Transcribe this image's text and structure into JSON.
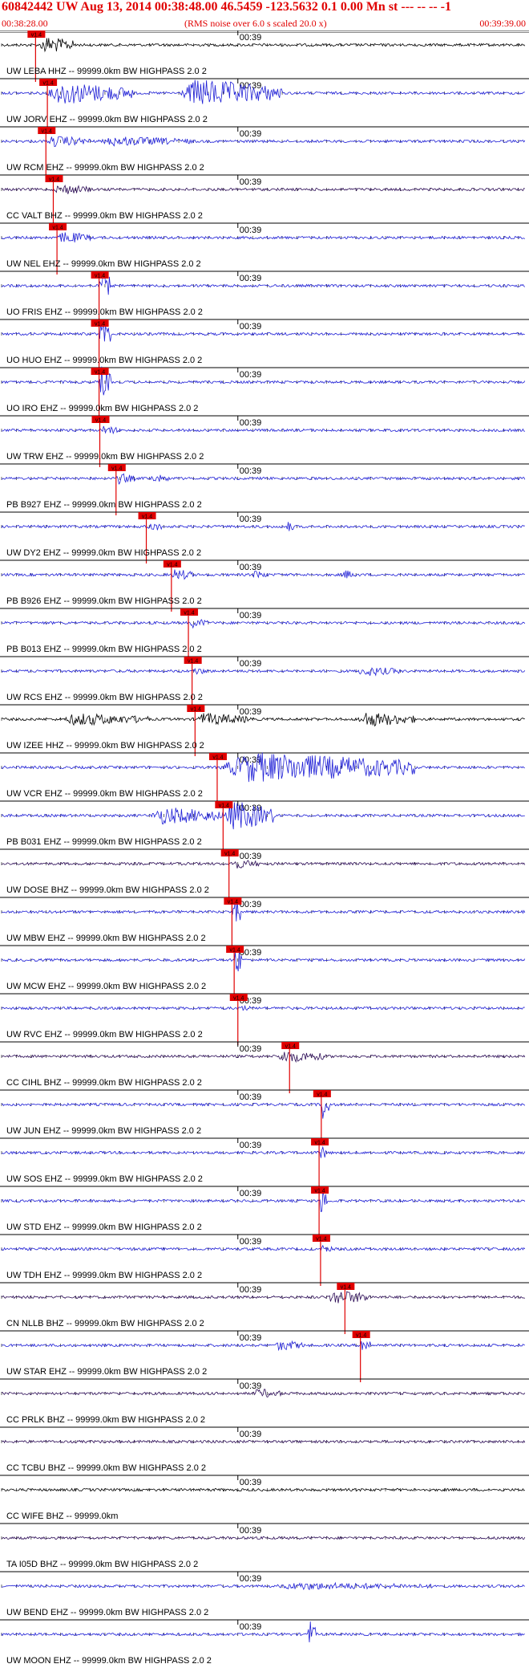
{
  "header": {
    "title": "60842442 UW Aug 13, 2014 00:38:48.00   46.5459 -123.5632  0.1 0.00 Mn st --- -- --  -1",
    "subtitle": "(RMS noise over 6.0 s scaled 20.0 x)",
    "time_start": "00:38:28.00",
    "time_end": "00:39:39.00"
  },
  "chart_data": {
    "type": "line",
    "title": "60842442 UW Aug 13, 2014 00:38:48.00   46.5459 -123.5632  0.1 0.00 Mn st --- -- --  -1",
    "time_range_seconds": [
      0,
      71
    ],
    "minute_mark_label": "00:39",
    "minute_mark_second": 32,
    "pick_label": "v1.4",
    "colors": {
      "blue": "#1f1fd6",
      "black": "#000000",
      "purple": "#2a0a55",
      "pick": "#e00000"
    },
    "traces": [
      {
        "label": "UW LEBA HHZ -- 99999.0km BW  HIGHPASS  2.0  2",
        "color": "black",
        "pick_s": 4.6,
        "bursts": [
          {
            "t": [
              5,
              10
            ],
            "amp": 1.4
          }
        ]
      },
      {
        "label": "UW JORV EHZ -- 99999.0km BW  HIGHPASS  2.0  2",
        "color": "blue",
        "pick_s": 6.2,
        "bursts": [
          {
            "t": [
              6,
              18
            ],
            "amp": 1.8
          },
          {
            "t": [
              24,
              38
            ],
            "amp": 2.2
          }
        ]
      },
      {
        "label": "UW RCM EHZ -- 99999.0km BW  HIGHPASS  2.0  2",
        "color": "blue",
        "pick_s": 6.0,
        "bursts": [
          {
            "t": [
              6,
              12
            ],
            "amp": 0.9
          },
          {
            "t": [
              13,
              26
            ],
            "amp": 0.8
          }
        ]
      },
      {
        "label": "CC VALT BHZ -- 99999.0km BW  HIGHPASS  2.0  2",
        "color": "purple",
        "pick_s": 7.0,
        "bursts": [
          {
            "t": [
              7,
              12
            ],
            "amp": 0.9
          }
        ]
      },
      {
        "label": "UW NEL EHZ -- 99999.0km BW  HIGHPASS  2.0  2",
        "color": "blue",
        "pick_s": 7.5,
        "bursts": [
          {
            "t": [
              7.5,
              12
            ],
            "amp": 1.0
          }
        ]
      },
      {
        "label": "UO FRIS EHZ -- 99999.0km BW  HIGHPASS  2.0  2",
        "color": "blue",
        "pick_s": 13.2,
        "bursts": [
          {
            "t": [
              13.2,
              14.8
            ],
            "amp": 2.6
          }
        ]
      },
      {
        "label": "UO HUO EHZ -- 99999.0km BW  HIGHPASS  2.0  2",
        "color": "blue",
        "pick_s": 13.2,
        "bursts": [
          {
            "t": [
              13.2,
              14.8
            ],
            "amp": 2.6
          }
        ]
      },
      {
        "label": "UO IRO EHZ -- 99999.0km BW  HIGHPASS  2.0  2",
        "color": "blue",
        "pick_s": 13.2,
        "bursts": [
          {
            "t": [
              13.2,
              14.8
            ],
            "amp": 2.6
          }
        ]
      },
      {
        "label": "UW TRW EHZ -- 99999.0km BW  HIGHPASS  2.0  2",
        "color": "blue",
        "pick_s": 13.3,
        "bursts": [
          {
            "t": [
              13.3,
              16
            ],
            "amp": 0.8
          }
        ]
      },
      {
        "label": "PB B927 EHZ -- 99999.0km BW  HIGHPASS  2.0  2",
        "color": "blue",
        "pick_s": 15.5,
        "bursts": [
          {
            "t": [
              15.5,
              18
            ],
            "amp": 0.9
          },
          {
            "t": [
              20,
              23
            ],
            "amp": 0.7
          }
        ]
      },
      {
        "label": "UW DY2 EHZ -- 99999.0km BW  HIGHPASS  2.0  2",
        "color": "blue",
        "pick_s": 19.6,
        "bursts": [
          {
            "t": [
              19.6,
              22
            ],
            "amp": 0.8
          },
          {
            "t": [
              38.5,
              39.5
            ],
            "amp": 1.0
          }
        ]
      },
      {
        "label": "PB B926 EHZ -- 99999.0km BW  HIGHPASS  2.0  2",
        "color": "blue",
        "pick_s": 23.0,
        "bursts": [
          {
            "t": [
              23,
              26
            ],
            "amp": 1.0
          },
          {
            "t": [
              34,
              36
            ],
            "amp": 0.8
          },
          {
            "t": [
              46,
              48
            ],
            "amp": 0.8
          }
        ]
      },
      {
        "label": "PB B013 EHZ -- 99999.0km BW  HIGHPASS  2.0  2",
        "color": "blue",
        "pick_s": 25.3,
        "bursts": [
          {
            "t": [
              25.3,
              28
            ],
            "amp": 0.8
          }
        ]
      },
      {
        "label": "UW RCS EHZ -- 99999.0km BW  HIGHPASS  2.0  2",
        "color": "blue",
        "pick_s": 25.8,
        "bursts": [
          {
            "t": [
              25.8,
              28
            ],
            "amp": 0.6
          },
          {
            "t": [
              48,
              54
            ],
            "amp": 0.8
          }
        ]
      },
      {
        "label": "UW IZEE HHZ -- 99999.0km BW  HIGHPASS  2.0  2",
        "color": "black",
        "pick_s": 26.2,
        "bursts": [
          {
            "t": [
              8,
              20
            ],
            "amp": 1.0
          },
          {
            "t": [
              26,
              34
            ],
            "amp": 1.0
          },
          {
            "t": [
              48,
              56
            ],
            "amp": 1.2
          }
        ]
      },
      {
        "label": "UW VCR EHZ -- 99999.0km BW  HIGHPASS  2.0  2",
        "color": "blue",
        "pick_s": 29.2,
        "bursts": [
          {
            "t": [
              29.2,
              56
            ],
            "amp": 2.4
          }
        ]
      },
      {
        "label": "PB B031 EHZ -- 99999.0km BW  HIGHPASS  2.0  2",
        "color": "blue",
        "pick_s": 30.0,
        "bursts": [
          {
            "t": [
              20,
              30
            ],
            "amp": 1.4
          },
          {
            "t": [
              30,
              37
            ],
            "amp": 2.4
          }
        ]
      },
      {
        "label": "UW DOSE BHZ -- 99999.0km BW  HIGHPASS  2.0  2",
        "color": "purple",
        "pick_s": 30.8,
        "bursts": [
          {
            "t": [
              30.8,
              35
            ],
            "amp": 0.8
          }
        ]
      },
      {
        "label": "UW MBW EHZ -- 99999.0km BW  HIGHPASS  2.0  2",
        "color": "blue",
        "pick_s": 31.2,
        "bursts": [
          {
            "t": [
              31.2,
              32.4
            ],
            "amp": 2.6
          }
        ]
      },
      {
        "label": "UW MCW EHZ -- 99999.0km BW  HIGHPASS  2.0  2",
        "color": "blue",
        "pick_s": 31.5,
        "bursts": [
          {
            "t": [
              31.5,
              32.6
            ],
            "amp": 2.6
          }
        ]
      },
      {
        "label": "UW RVC EHZ -- 99999.0km BW  HIGHPASS  2.0  2",
        "color": "blue",
        "pick_s": 32.0,
        "bursts": [
          {
            "t": [
              32,
              34
            ],
            "amp": 0.5
          }
        ]
      },
      {
        "label": "CC CIHL BHZ -- 99999.0km BW  HIGHPASS  2.0  2",
        "color": "purple",
        "pick_s": 39.0,
        "bursts": [
          {
            "t": [
              37,
              44
            ],
            "amp": 1.0
          }
        ]
      },
      {
        "label": "UW JUN EHZ -- 99999.0km BW  HIGHPASS  2.0  2",
        "color": "blue",
        "pick_s": 43.3,
        "bursts": [
          {
            "t": [
              43.3,
              44.5
            ],
            "amp": 2.6
          }
        ]
      },
      {
        "label": "UW SOS EHZ -- 99999.0km BW  HIGHPASS  2.0  2",
        "color": "blue",
        "pick_s": 43.0,
        "bursts": [
          {
            "t": [
              43,
              44
            ],
            "amp": 1.4
          }
        ]
      },
      {
        "label": "UW STD EHZ -- 99999.0km BW  HIGHPASS  2.0  2",
        "color": "blue",
        "pick_s": 43.0,
        "bursts": [
          {
            "t": [
              43,
              44.3
            ],
            "amp": 2.0
          }
        ]
      },
      {
        "label": "UW TDH EHZ -- 99999.0km BW  HIGHPASS  2.0  2",
        "color": "blue",
        "pick_s": 43.2,
        "bursts": [
          {
            "t": [
              43.2,
              45
            ],
            "amp": 0.6
          }
        ]
      },
      {
        "label": "CN NLLB BHZ -- 99999.0km BW  HIGHPASS  2.0  2",
        "color": "purple",
        "pick_s": 46.5,
        "bursts": [
          {
            "t": [
              44,
              50
            ],
            "amp": 1.2
          }
        ]
      },
      {
        "label": "UW STAR EHZ -- 99999.0km BW  HIGHPASS  2.0  2",
        "color": "blue",
        "pick_s": 48.6,
        "bursts": [
          {
            "t": [
              37,
              41
            ],
            "amp": 0.9
          },
          {
            "t": [
              48.6,
              50
            ],
            "amp": 1.6
          }
        ]
      },
      {
        "label": "CC PRLK BHZ -- 99999.0km BW  HIGHPASS  2.0  2",
        "color": "purple",
        "pick_s": null,
        "bursts": [
          {
            "t": [
              34,
              38
            ],
            "amp": 0.8
          }
        ]
      },
      {
        "label": "CC TCBU BHZ -- 99999.0km BW  HIGHPASS  2.0  2",
        "color": "purple",
        "pick_s": null,
        "bursts": []
      },
      {
        "label": "CC WIFE BHZ -- 99999.0km",
        "color": "black",
        "pick_s": null,
        "bursts": []
      },
      {
        "label": "TA I05D BHZ -- 99999.0km BW  HIGHPASS  2.0  2",
        "color": "purple",
        "pick_s": null,
        "bursts": []
      },
      {
        "label": "UW BEND EHZ -- 99999.0km BW  HIGHPASS  2.0  2",
        "color": "blue",
        "pick_s": null,
        "bursts": [
          {
            "t": [
              36,
              60
            ],
            "amp": 0.6
          }
        ]
      },
      {
        "label": "UW MOON EHZ -- 99999.0km BW  HIGHPASS  2.0  2",
        "color": "blue",
        "pick_s": null,
        "bursts": [
          {
            "t": [
              41.5,
              42.5
            ],
            "amp": 2.4
          }
        ]
      }
    ]
  }
}
